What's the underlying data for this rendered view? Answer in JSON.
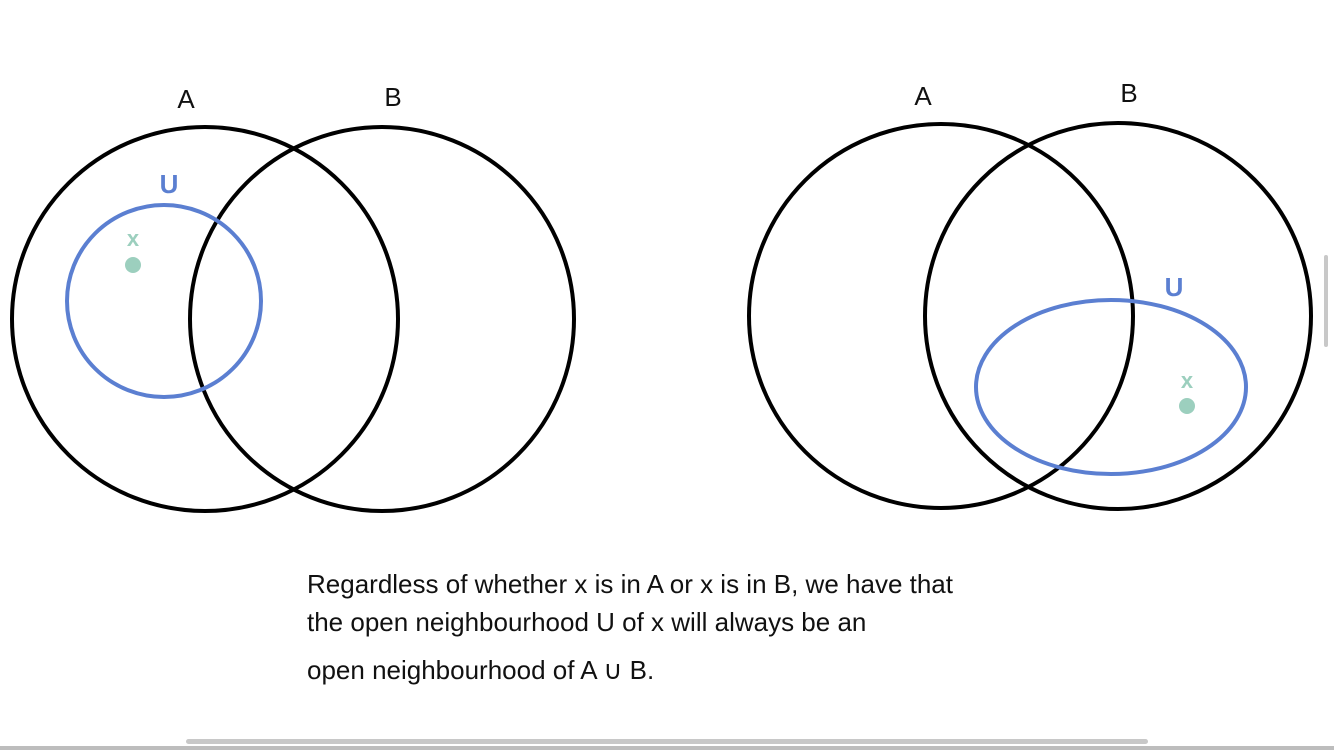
{
  "left_diagram": {
    "set_a_label": "A",
    "set_b_label": "B",
    "neighbourhood_label": "U",
    "point_label": "x"
  },
  "right_diagram": {
    "set_a_label": "A",
    "set_b_label": "B",
    "neighbourhood_label": "U",
    "point_label": "x"
  },
  "caption": {
    "line1": "Regardless of whether x is in A or x is in B, we have that",
    "line2": "the open neighbourhood U of x will always be an",
    "line3": "open neighbourhood of A ∪ B."
  },
  "colors": {
    "set_outline": "#000000",
    "neighbourhood": "#5b7fd1",
    "point": "#9ccfbe"
  }
}
